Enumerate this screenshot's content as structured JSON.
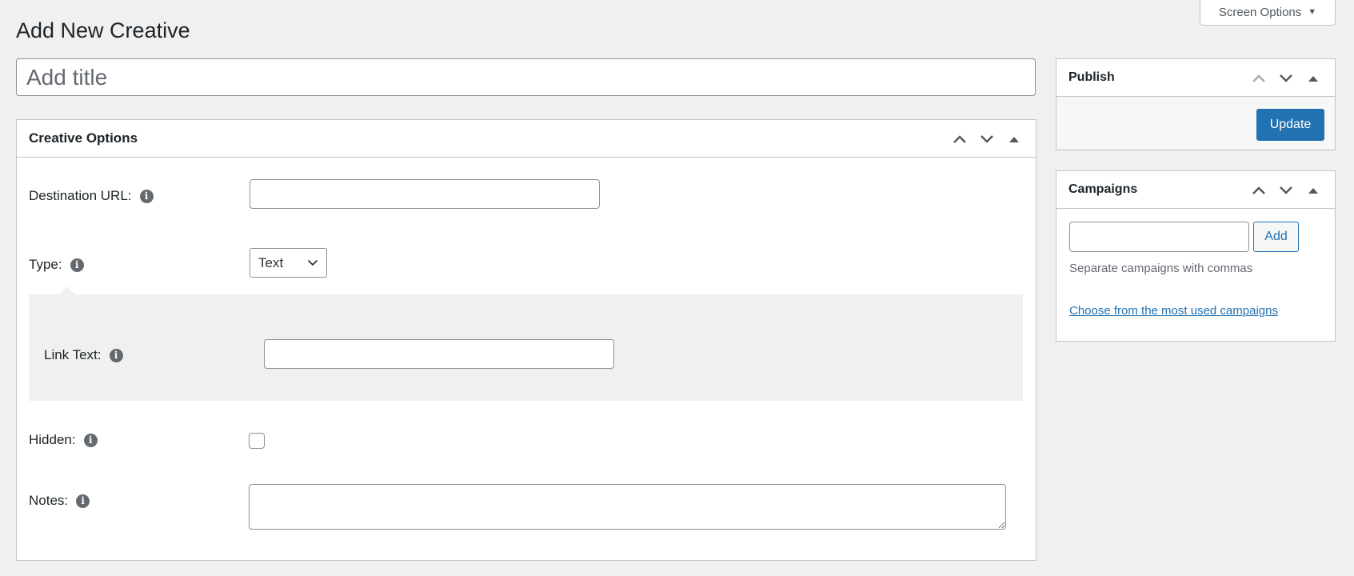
{
  "screen_options": {
    "label": "Screen Options",
    "icon": "triangle-down-icon"
  },
  "page": {
    "title": "Add New Creative"
  },
  "title_input": {
    "placeholder": "Add title",
    "value": ""
  },
  "creative_options": {
    "title": "Creative Options",
    "controls": {
      "move_up": "chevron-up-icon",
      "move_down": "chevron-down-icon",
      "toggle": "triangle-up-icon"
    },
    "fields": {
      "destination_url": {
        "label": "Destination URL:",
        "value": ""
      },
      "type": {
        "label": "Type:",
        "selected": "Text"
      },
      "link_text": {
        "label": "Link Text:",
        "value": ""
      },
      "hidden": {
        "label": "Hidden:",
        "checked": false
      },
      "notes": {
        "label": "Notes:",
        "value": ""
      }
    },
    "info_icon_glyph": "i"
  },
  "publish": {
    "title": "Publish",
    "update_label": "Update"
  },
  "campaigns": {
    "title": "Campaigns",
    "input_value": "",
    "add_label": "Add",
    "help_text": "Separate campaigns with commas",
    "link_text": "Choose from the most used campaigns"
  },
  "colors": {
    "background": "#f0f0f1",
    "primary": "#2271b1",
    "panel_gray": "#f0f0f0",
    "border": "#c3c4c7"
  }
}
